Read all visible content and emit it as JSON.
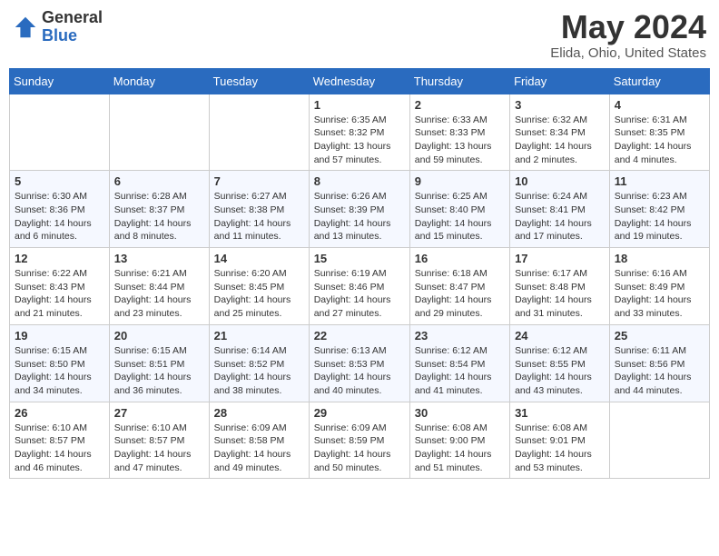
{
  "header": {
    "logo_general": "General",
    "logo_blue": "Blue",
    "month_year": "May 2024",
    "location": "Elida, Ohio, United States"
  },
  "weekdays": [
    "Sunday",
    "Monday",
    "Tuesday",
    "Wednesday",
    "Thursday",
    "Friday",
    "Saturday"
  ],
  "weeks": [
    [
      {
        "day": null
      },
      {
        "day": null
      },
      {
        "day": null
      },
      {
        "day": "1",
        "sunrise": "Sunrise: 6:35 AM",
        "sunset": "Sunset: 8:32 PM",
        "daylight": "Daylight: 13 hours and 57 minutes."
      },
      {
        "day": "2",
        "sunrise": "Sunrise: 6:33 AM",
        "sunset": "Sunset: 8:33 PM",
        "daylight": "Daylight: 13 hours and 59 minutes."
      },
      {
        "day": "3",
        "sunrise": "Sunrise: 6:32 AM",
        "sunset": "Sunset: 8:34 PM",
        "daylight": "Daylight: 14 hours and 2 minutes."
      },
      {
        "day": "4",
        "sunrise": "Sunrise: 6:31 AM",
        "sunset": "Sunset: 8:35 PM",
        "daylight": "Daylight: 14 hours and 4 minutes."
      }
    ],
    [
      {
        "day": "5",
        "sunrise": "Sunrise: 6:30 AM",
        "sunset": "Sunset: 8:36 PM",
        "daylight": "Daylight: 14 hours and 6 minutes."
      },
      {
        "day": "6",
        "sunrise": "Sunrise: 6:28 AM",
        "sunset": "Sunset: 8:37 PM",
        "daylight": "Daylight: 14 hours and 8 minutes."
      },
      {
        "day": "7",
        "sunrise": "Sunrise: 6:27 AM",
        "sunset": "Sunset: 8:38 PM",
        "daylight": "Daylight: 14 hours and 11 minutes."
      },
      {
        "day": "8",
        "sunrise": "Sunrise: 6:26 AM",
        "sunset": "Sunset: 8:39 PM",
        "daylight": "Daylight: 14 hours and 13 minutes."
      },
      {
        "day": "9",
        "sunrise": "Sunrise: 6:25 AM",
        "sunset": "Sunset: 8:40 PM",
        "daylight": "Daylight: 14 hours and 15 minutes."
      },
      {
        "day": "10",
        "sunrise": "Sunrise: 6:24 AM",
        "sunset": "Sunset: 8:41 PM",
        "daylight": "Daylight: 14 hours and 17 minutes."
      },
      {
        "day": "11",
        "sunrise": "Sunrise: 6:23 AM",
        "sunset": "Sunset: 8:42 PM",
        "daylight": "Daylight: 14 hours and 19 minutes."
      }
    ],
    [
      {
        "day": "12",
        "sunrise": "Sunrise: 6:22 AM",
        "sunset": "Sunset: 8:43 PM",
        "daylight": "Daylight: 14 hours and 21 minutes."
      },
      {
        "day": "13",
        "sunrise": "Sunrise: 6:21 AM",
        "sunset": "Sunset: 8:44 PM",
        "daylight": "Daylight: 14 hours and 23 minutes."
      },
      {
        "day": "14",
        "sunrise": "Sunrise: 6:20 AM",
        "sunset": "Sunset: 8:45 PM",
        "daylight": "Daylight: 14 hours and 25 minutes."
      },
      {
        "day": "15",
        "sunrise": "Sunrise: 6:19 AM",
        "sunset": "Sunset: 8:46 PM",
        "daylight": "Daylight: 14 hours and 27 minutes."
      },
      {
        "day": "16",
        "sunrise": "Sunrise: 6:18 AM",
        "sunset": "Sunset: 8:47 PM",
        "daylight": "Daylight: 14 hours and 29 minutes."
      },
      {
        "day": "17",
        "sunrise": "Sunrise: 6:17 AM",
        "sunset": "Sunset: 8:48 PM",
        "daylight": "Daylight: 14 hours and 31 minutes."
      },
      {
        "day": "18",
        "sunrise": "Sunrise: 6:16 AM",
        "sunset": "Sunset: 8:49 PM",
        "daylight": "Daylight: 14 hours and 33 minutes."
      }
    ],
    [
      {
        "day": "19",
        "sunrise": "Sunrise: 6:15 AM",
        "sunset": "Sunset: 8:50 PM",
        "daylight": "Daylight: 14 hours and 34 minutes."
      },
      {
        "day": "20",
        "sunrise": "Sunrise: 6:15 AM",
        "sunset": "Sunset: 8:51 PM",
        "daylight": "Daylight: 14 hours and 36 minutes."
      },
      {
        "day": "21",
        "sunrise": "Sunrise: 6:14 AM",
        "sunset": "Sunset: 8:52 PM",
        "daylight": "Daylight: 14 hours and 38 minutes."
      },
      {
        "day": "22",
        "sunrise": "Sunrise: 6:13 AM",
        "sunset": "Sunset: 8:53 PM",
        "daylight": "Daylight: 14 hours and 40 minutes."
      },
      {
        "day": "23",
        "sunrise": "Sunrise: 6:12 AM",
        "sunset": "Sunset: 8:54 PM",
        "daylight": "Daylight: 14 hours and 41 minutes."
      },
      {
        "day": "24",
        "sunrise": "Sunrise: 6:12 AM",
        "sunset": "Sunset: 8:55 PM",
        "daylight": "Daylight: 14 hours and 43 minutes."
      },
      {
        "day": "25",
        "sunrise": "Sunrise: 6:11 AM",
        "sunset": "Sunset: 8:56 PM",
        "daylight": "Daylight: 14 hours and 44 minutes."
      }
    ],
    [
      {
        "day": "26",
        "sunrise": "Sunrise: 6:10 AM",
        "sunset": "Sunset: 8:57 PM",
        "daylight": "Daylight: 14 hours and 46 minutes."
      },
      {
        "day": "27",
        "sunrise": "Sunrise: 6:10 AM",
        "sunset": "Sunset: 8:57 PM",
        "daylight": "Daylight: 14 hours and 47 minutes."
      },
      {
        "day": "28",
        "sunrise": "Sunrise: 6:09 AM",
        "sunset": "Sunset: 8:58 PM",
        "daylight": "Daylight: 14 hours and 49 minutes."
      },
      {
        "day": "29",
        "sunrise": "Sunrise: 6:09 AM",
        "sunset": "Sunset: 8:59 PM",
        "daylight": "Daylight: 14 hours and 50 minutes."
      },
      {
        "day": "30",
        "sunrise": "Sunrise: 6:08 AM",
        "sunset": "Sunset: 9:00 PM",
        "daylight": "Daylight: 14 hours and 51 minutes."
      },
      {
        "day": "31",
        "sunrise": "Sunrise: 6:08 AM",
        "sunset": "Sunset: 9:01 PM",
        "daylight": "Daylight: 14 hours and 53 minutes."
      },
      {
        "day": null
      }
    ]
  ]
}
